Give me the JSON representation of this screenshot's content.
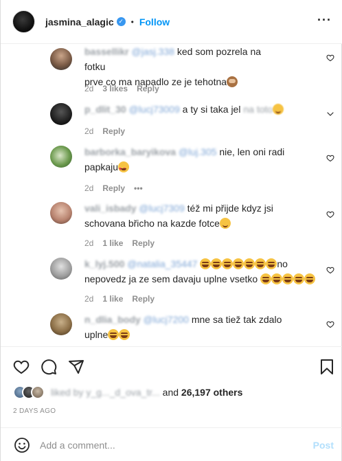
{
  "header": {
    "username": "jasmina_alagic",
    "verified_mark": "✓",
    "separator": "•",
    "follow_label": "Follow",
    "more_label": "•••"
  },
  "comments": [
    {
      "username": "bassellikr",
      "mention": "@jasj.338",
      "text_line1": "ked som pozrela na fotku",
      "text_line2": "prve co ma napadlo ze je tehotna",
      "emoji": "monkey-see-no-evil",
      "time": "2d",
      "likes": "3 likes",
      "reply": "Reply",
      "icon": "heart-icon"
    },
    {
      "username": "p_dlit_30",
      "mention": "@lucj73009",
      "text_line1": "a ty si taka jel",
      "text_blur": "na toto",
      "emoji": "grin",
      "time": "2d",
      "reply": "Reply",
      "icon": "chevron-down-icon"
    },
    {
      "username": "barborka_baryikova",
      "mention": "@luj.305",
      "text_line1": "nie, len oni radi",
      "text_line2": "papkaju",
      "emoji": "heart-eyes",
      "time": "2d",
      "reply": "Reply",
      "more": "•••",
      "icon": "heart-icon"
    },
    {
      "username": "vali_isbady",
      "mention": "@lucj7309",
      "text_line1": "též mi přijde kdyz jsi",
      "text_line2": "schovana břicho na kazde fotce",
      "emoji": "smile",
      "time": "2d",
      "likes": "1 like",
      "reply": "Reply",
      "icon": "heart-icon"
    },
    {
      "username": "k_lyj.500",
      "mention": "@natalia_35447",
      "text_line1": "no",
      "text_line2": "nepovedz ja ze sem davaju uplne vsetko",
      "emoji": "laugh",
      "time": "2d",
      "likes": "1 like",
      "reply": "Reply",
      "icon": "heart-icon"
    },
    {
      "username": "n_dlia_body",
      "mention": "@lucj7200",
      "text_line1": "mne sa tiež tak zdalo",
      "text_line2": "uplne",
      "emoji": "grin",
      "icon": "heart-icon"
    }
  ],
  "actions": {
    "like_icon": "heart-icon",
    "comment_icon": "comment-icon",
    "share_icon": "share-icon",
    "save_icon": "bookmark-icon"
  },
  "likes": {
    "blurred_names": "liked by y_g..._d_ova_tr...",
    "and_label": "and",
    "others_label": "26,197 others"
  },
  "post_time": "2 DAYS AGO",
  "comment_box": {
    "placeholder": "Add a comment...",
    "post_label": "Post"
  },
  "colors": {
    "accent": "#0095f6",
    "post_disabled": "#b2dffc",
    "text": "#262626",
    "muted": "#8e8e8e"
  }
}
